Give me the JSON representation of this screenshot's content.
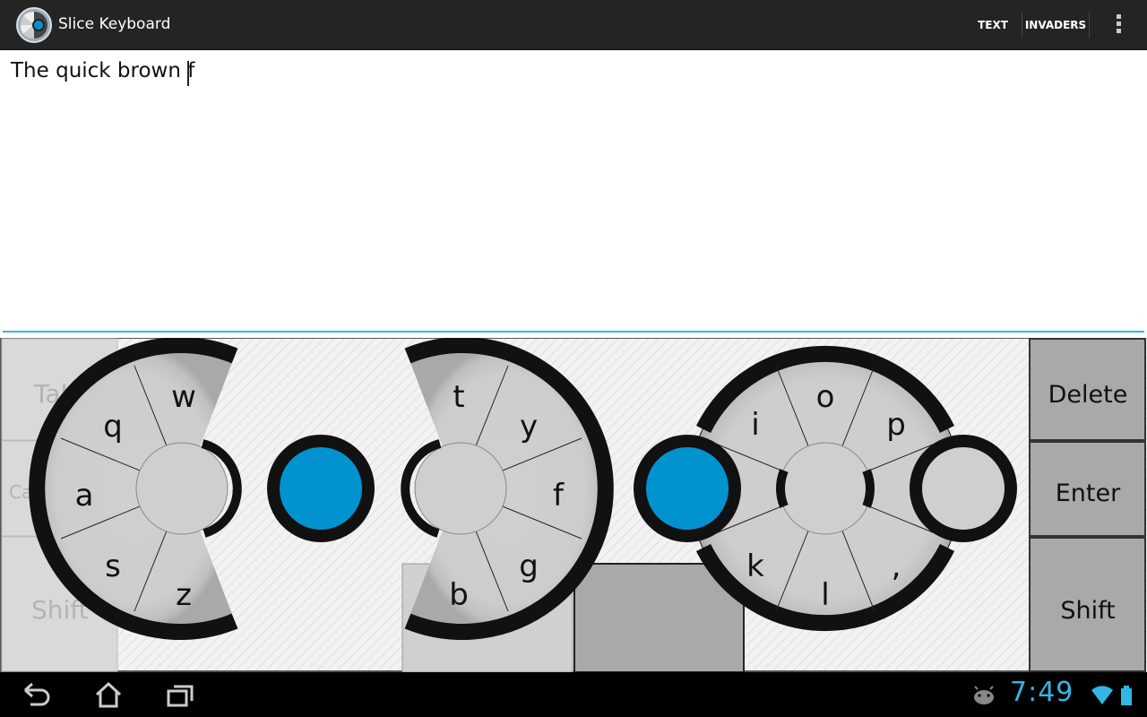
{
  "action_bar": {
    "title": "Slice Keyboard",
    "actions": [
      "TEXT",
      "INVADERS"
    ],
    "overflow_icon": "overflow-menu-icon"
  },
  "editor": {
    "text": "The quick brown f"
  },
  "keyboard": {
    "left_ring": {
      "top": "w",
      "upper_left": "q",
      "left": "a",
      "lower_left": "s",
      "bottom": "z"
    },
    "middle_ring": {
      "top": "t",
      "upper_right": "y",
      "right": "f",
      "lower_right": "g",
      "bottom": "b"
    },
    "right_ring": {
      "upper_left": "i",
      "top": "o",
      "upper_right": "p",
      "lower_left": "k",
      "bottom": "l",
      "lower_right": ","
    },
    "left_keys": {
      "tab": "Tab",
      "caps": "Caps",
      "shift": "Shift"
    },
    "right_keys": {
      "delete": "Delete",
      "enter": "Enter",
      "shift": "Shift"
    },
    "accent_color": "#0093d0"
  },
  "status_bar": {
    "time": "7:49",
    "icons": [
      "android-debug-icon",
      "wifi-icon",
      "battery-icon"
    ]
  },
  "nav_bar": {
    "icons": [
      "back-icon",
      "home-icon",
      "recent-apps-icon"
    ]
  }
}
